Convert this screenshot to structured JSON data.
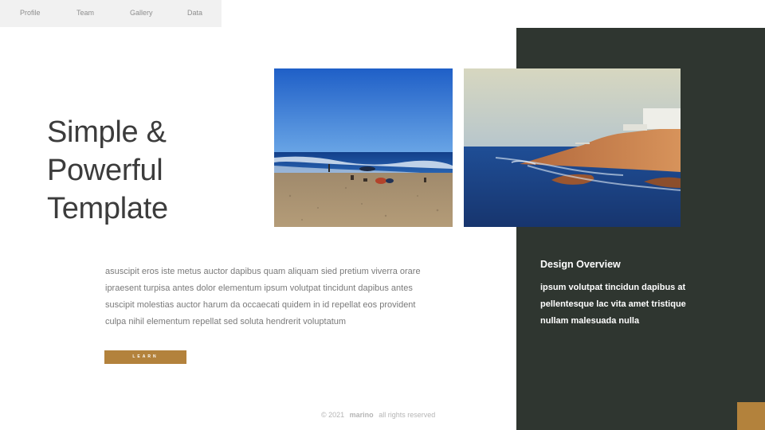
{
  "nav": {
    "items": [
      {
        "label": "Profile"
      },
      {
        "label": "Team"
      },
      {
        "label": "Gallery"
      },
      {
        "label": "Data"
      }
    ]
  },
  "hero": {
    "title_lines": [
      "Simple &",
      "Powerful",
      "Template"
    ]
  },
  "body": {
    "lines": [
      "asuscipit eros iste metus auctor dapibus quam aliquam sied pretium viverra orare",
      "ipraesent turpisa antes dolor elementum ipsum volutpat tincidunt dapibus antes",
      "suscipit molestias auctor harum da occaecati quidem in id repellat eos provident",
      "culpa nihil elementum repellat sed soluta hendrerit voluptatum"
    ],
    "button_label": "LEARN"
  },
  "overview": {
    "title": "Design Overview",
    "lines": [
      "ipsum volutpat tincidun dapibus at",
      "pellentesque lac vita amet tristique",
      "nullam malesuada nulla"
    ]
  },
  "footer": {
    "copyright": "© 2021",
    "brand": "marino",
    "rights": "all rights reserved"
  },
  "colors": {
    "accent": "#b3823c",
    "dark_panel": "#2f3630",
    "nav_bg": "#f1f1f1"
  },
  "images": [
    {
      "name": "beach-photo"
    },
    {
      "name": "coastal-cliff-photo"
    }
  ]
}
